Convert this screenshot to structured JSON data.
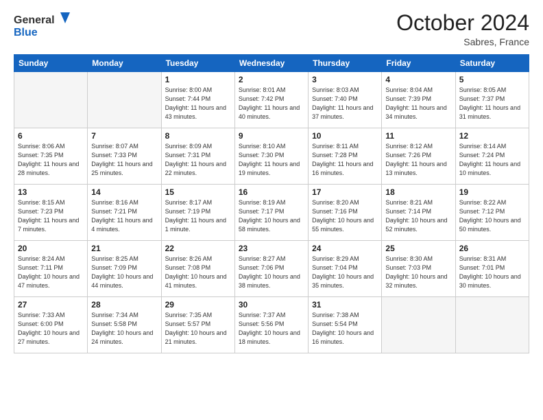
{
  "header": {
    "logo_line1": "General",
    "logo_line2": "Blue",
    "month": "October 2024",
    "location": "Sabres, France"
  },
  "days_of_week": [
    "Sunday",
    "Monday",
    "Tuesday",
    "Wednesday",
    "Thursday",
    "Friday",
    "Saturday"
  ],
  "weeks": [
    [
      {
        "day": "",
        "info": ""
      },
      {
        "day": "",
        "info": ""
      },
      {
        "day": "1",
        "info": "Sunrise: 8:00 AM\nSunset: 7:44 PM\nDaylight: 11 hours and 43 minutes."
      },
      {
        "day": "2",
        "info": "Sunrise: 8:01 AM\nSunset: 7:42 PM\nDaylight: 11 hours and 40 minutes."
      },
      {
        "day": "3",
        "info": "Sunrise: 8:03 AM\nSunset: 7:40 PM\nDaylight: 11 hours and 37 minutes."
      },
      {
        "day": "4",
        "info": "Sunrise: 8:04 AM\nSunset: 7:39 PM\nDaylight: 11 hours and 34 minutes."
      },
      {
        "day": "5",
        "info": "Sunrise: 8:05 AM\nSunset: 7:37 PM\nDaylight: 11 hours and 31 minutes."
      }
    ],
    [
      {
        "day": "6",
        "info": "Sunrise: 8:06 AM\nSunset: 7:35 PM\nDaylight: 11 hours and 28 minutes."
      },
      {
        "day": "7",
        "info": "Sunrise: 8:07 AM\nSunset: 7:33 PM\nDaylight: 11 hours and 25 minutes."
      },
      {
        "day": "8",
        "info": "Sunrise: 8:09 AM\nSunset: 7:31 PM\nDaylight: 11 hours and 22 minutes."
      },
      {
        "day": "9",
        "info": "Sunrise: 8:10 AM\nSunset: 7:30 PM\nDaylight: 11 hours and 19 minutes."
      },
      {
        "day": "10",
        "info": "Sunrise: 8:11 AM\nSunset: 7:28 PM\nDaylight: 11 hours and 16 minutes."
      },
      {
        "day": "11",
        "info": "Sunrise: 8:12 AM\nSunset: 7:26 PM\nDaylight: 11 hours and 13 minutes."
      },
      {
        "day": "12",
        "info": "Sunrise: 8:14 AM\nSunset: 7:24 PM\nDaylight: 11 hours and 10 minutes."
      }
    ],
    [
      {
        "day": "13",
        "info": "Sunrise: 8:15 AM\nSunset: 7:23 PM\nDaylight: 11 hours and 7 minutes."
      },
      {
        "day": "14",
        "info": "Sunrise: 8:16 AM\nSunset: 7:21 PM\nDaylight: 11 hours and 4 minutes."
      },
      {
        "day": "15",
        "info": "Sunrise: 8:17 AM\nSunset: 7:19 PM\nDaylight: 11 hours and 1 minute."
      },
      {
        "day": "16",
        "info": "Sunrise: 8:19 AM\nSunset: 7:17 PM\nDaylight: 10 hours and 58 minutes."
      },
      {
        "day": "17",
        "info": "Sunrise: 8:20 AM\nSunset: 7:16 PM\nDaylight: 10 hours and 55 minutes."
      },
      {
        "day": "18",
        "info": "Sunrise: 8:21 AM\nSunset: 7:14 PM\nDaylight: 10 hours and 52 minutes."
      },
      {
        "day": "19",
        "info": "Sunrise: 8:22 AM\nSunset: 7:12 PM\nDaylight: 10 hours and 50 minutes."
      }
    ],
    [
      {
        "day": "20",
        "info": "Sunrise: 8:24 AM\nSunset: 7:11 PM\nDaylight: 10 hours and 47 minutes."
      },
      {
        "day": "21",
        "info": "Sunrise: 8:25 AM\nSunset: 7:09 PM\nDaylight: 10 hours and 44 minutes."
      },
      {
        "day": "22",
        "info": "Sunrise: 8:26 AM\nSunset: 7:08 PM\nDaylight: 10 hours and 41 minutes."
      },
      {
        "day": "23",
        "info": "Sunrise: 8:27 AM\nSunset: 7:06 PM\nDaylight: 10 hours and 38 minutes."
      },
      {
        "day": "24",
        "info": "Sunrise: 8:29 AM\nSunset: 7:04 PM\nDaylight: 10 hours and 35 minutes."
      },
      {
        "day": "25",
        "info": "Sunrise: 8:30 AM\nSunset: 7:03 PM\nDaylight: 10 hours and 32 minutes."
      },
      {
        "day": "26",
        "info": "Sunrise: 8:31 AM\nSunset: 7:01 PM\nDaylight: 10 hours and 30 minutes."
      }
    ],
    [
      {
        "day": "27",
        "info": "Sunrise: 7:33 AM\nSunset: 6:00 PM\nDaylight: 10 hours and 27 minutes."
      },
      {
        "day": "28",
        "info": "Sunrise: 7:34 AM\nSunset: 5:58 PM\nDaylight: 10 hours and 24 minutes."
      },
      {
        "day": "29",
        "info": "Sunrise: 7:35 AM\nSunset: 5:57 PM\nDaylight: 10 hours and 21 minutes."
      },
      {
        "day": "30",
        "info": "Sunrise: 7:37 AM\nSunset: 5:56 PM\nDaylight: 10 hours and 18 minutes."
      },
      {
        "day": "31",
        "info": "Sunrise: 7:38 AM\nSunset: 5:54 PM\nDaylight: 10 hours and 16 minutes."
      },
      {
        "day": "",
        "info": ""
      },
      {
        "day": "",
        "info": ""
      }
    ]
  ]
}
